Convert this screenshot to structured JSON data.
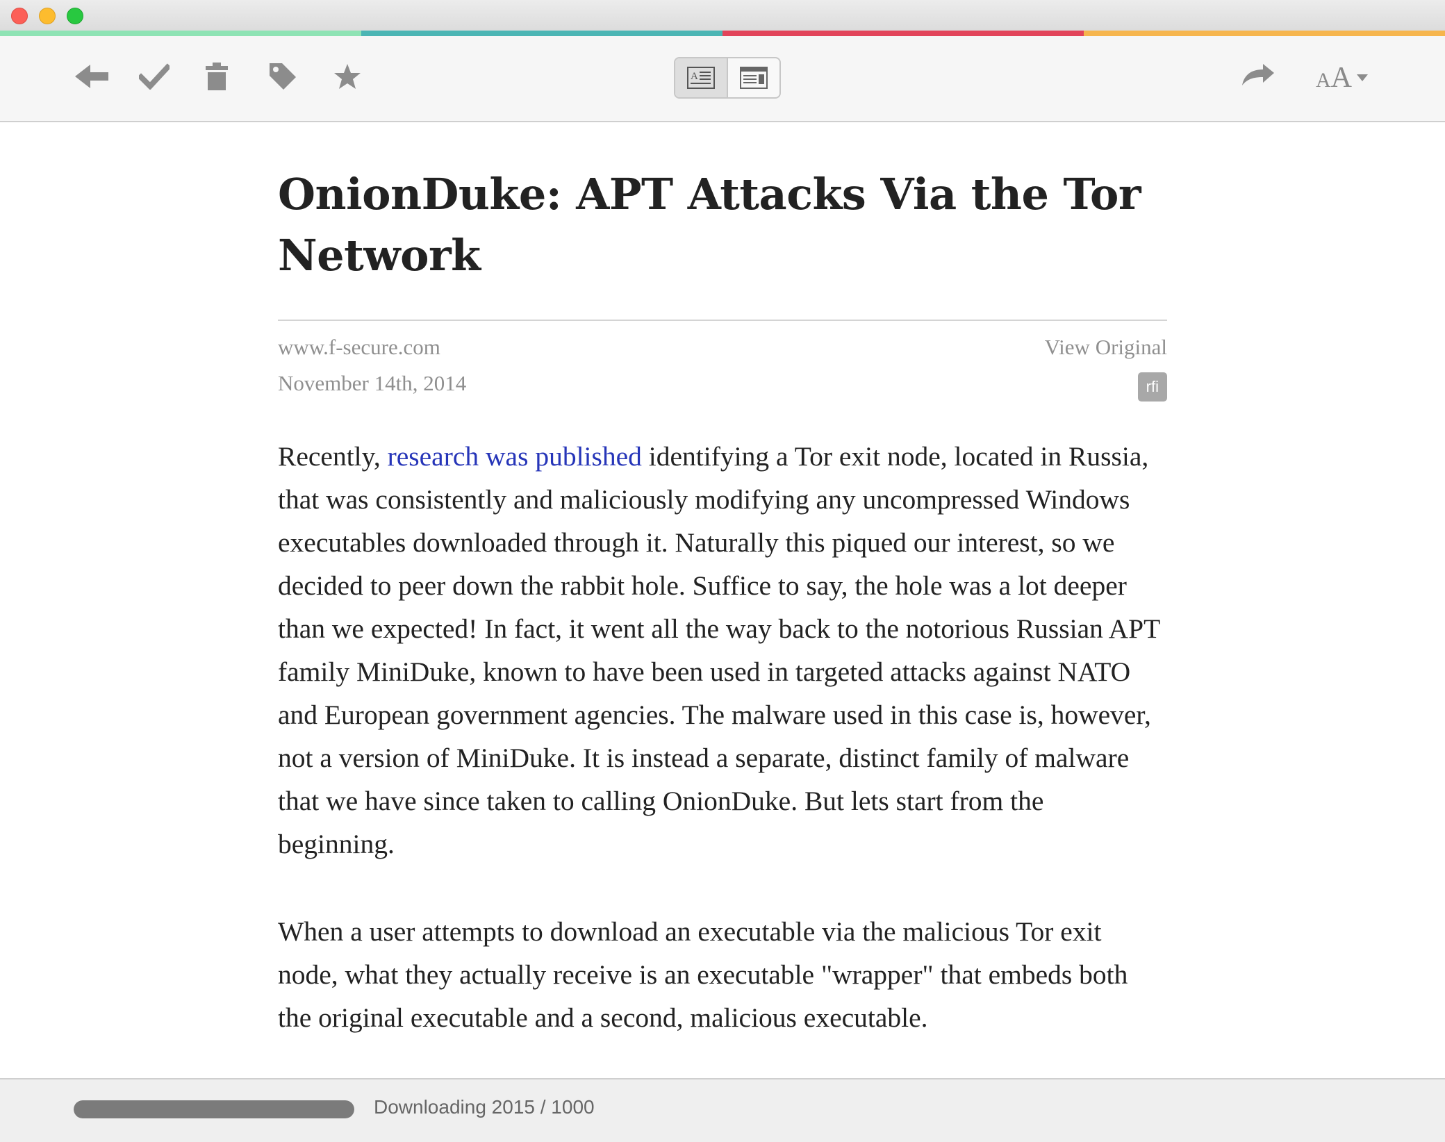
{
  "window": {
    "controls": [
      "close",
      "minimize",
      "maximize"
    ]
  },
  "theme": {
    "strip_colors": [
      "#8ee3b4",
      "#4bb5b4",
      "#e2445a",
      "#f6b54d"
    ],
    "icon_color": "#8c8c8c",
    "link_color": "#2635b8"
  },
  "toolbar": {
    "left_icons": [
      "back-arrow-icon",
      "checkmark-icon",
      "trash-icon",
      "tag-icon",
      "star-icon"
    ],
    "view_modes": [
      "article-view-icon",
      "web-view-icon"
    ],
    "active_view_mode": "article-view-icon",
    "right_icons": [
      "share-icon",
      "font-size-icon"
    ],
    "font_small": "A",
    "font_large": "A"
  },
  "article": {
    "title": "OnionDuke: APT Attacks Via the Tor Network",
    "domain": "www.f-secure.com",
    "date": "November 14th, 2014",
    "view_original": "View Original",
    "badge": "rfi",
    "p1_before_link": "Recently, ",
    "p1_link": "research was published",
    "p1_after_link": " identifying a Tor exit node, located in Russia, that was consistently and maliciously modifying any uncompressed Windows executables downloaded through it. Naturally this piqued our interest, so we decided to peer down the rabbit hole. Suffice to say, the hole was a lot deeper than we expected! In fact, it went all the way back to the notorious Russian APT family MiniDuke, known to have been used in targeted attacks against NATO and European government agencies. The malware used in this case is, however, not a version of MiniDuke. It is instead a separate, distinct family of malware that we have since taken to calling OnionDuke. But lets start from the beginning.",
    "p2": "When a user attempts to download an executable via the malicious Tor exit node, what they actually receive is an executable \"wrapper\" that embeds both the original executable and a second, malicious executable."
  },
  "status": {
    "text": "Downloading 2015 / 1000",
    "progress": 1.0
  }
}
